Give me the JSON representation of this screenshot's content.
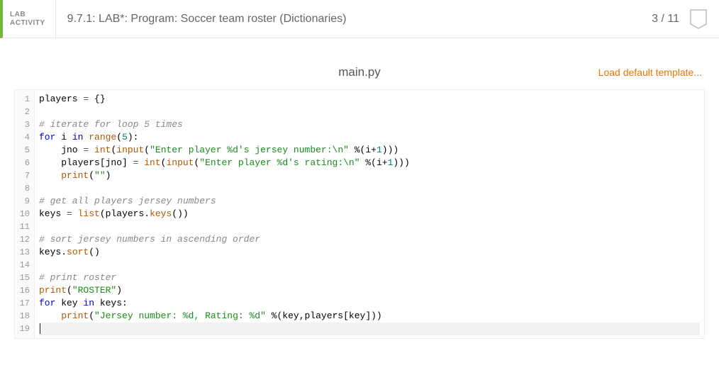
{
  "header": {
    "badge_line1": "LAB",
    "badge_line2": "ACTIVITY",
    "title": "9.7.1: LAB*: Program: Soccer team roster (Dictionaries)",
    "score": "3 / 11"
  },
  "file": {
    "name": "main.py",
    "load_template": "Load default template..."
  },
  "code_raw": "players = {}\n\n# iterate for loop 5 times\nfor i in range(5):\n    jno = int(input(\"Enter player %d's jersey number:\\n\" %(i+1)))\n    players[jno] = int(input(\"Enter player %d's rating:\\n\" %(i+1)))\n    print(\"\")\n\n# get all players jersey numbers\nkeys = list(players.keys())\n\n# sort jersey numbers in ascending order\nkeys.sort()\n\n# print roster\nprint(\"ROSTER\")\nfor key in keys:\n    print(\"Jersey number: %d, Rating: %d\" %(key,players[key]))\n",
  "code": [
    {
      "n": 1,
      "tokens": [
        {
          "t": "players ",
          "c": ""
        },
        {
          "t": "=",
          "c": "op"
        },
        {
          "t": " {}",
          "c": ""
        }
      ]
    },
    {
      "n": 2,
      "tokens": []
    },
    {
      "n": 3,
      "tokens": [
        {
          "t": "# iterate for loop 5 times",
          "c": "cmt"
        }
      ]
    },
    {
      "n": 4,
      "tokens": [
        {
          "t": "for",
          "c": "kw"
        },
        {
          "t": " i ",
          "c": ""
        },
        {
          "t": "in",
          "c": "kw"
        },
        {
          "t": " ",
          "c": ""
        },
        {
          "t": "range",
          "c": "fn"
        },
        {
          "t": "(",
          "c": ""
        },
        {
          "t": "5",
          "c": "num"
        },
        {
          "t": "):",
          "c": ""
        }
      ]
    },
    {
      "n": 5,
      "tokens": [
        {
          "t": "    jno ",
          "c": ""
        },
        {
          "t": "=",
          "c": "op"
        },
        {
          "t": " ",
          "c": ""
        },
        {
          "t": "int",
          "c": "fn"
        },
        {
          "t": "(",
          "c": ""
        },
        {
          "t": "input",
          "c": "fn"
        },
        {
          "t": "(",
          "c": ""
        },
        {
          "t": "\"Enter player %d's jersey number:\\n\"",
          "c": "str"
        },
        {
          "t": " %(i+",
          "c": ""
        },
        {
          "t": "1",
          "c": "num"
        },
        {
          "t": ")))",
          "c": ""
        }
      ]
    },
    {
      "n": 6,
      "tokens": [
        {
          "t": "    players[jno] ",
          "c": ""
        },
        {
          "t": "=",
          "c": "op"
        },
        {
          "t": " ",
          "c": ""
        },
        {
          "t": "int",
          "c": "fn"
        },
        {
          "t": "(",
          "c": ""
        },
        {
          "t": "input",
          "c": "fn"
        },
        {
          "t": "(",
          "c": ""
        },
        {
          "t": "\"Enter player %d's rating:\\n\"",
          "c": "str"
        },
        {
          "t": " %(i+",
          "c": ""
        },
        {
          "t": "1",
          "c": "num"
        },
        {
          "t": ")))",
          "c": ""
        }
      ]
    },
    {
      "n": 7,
      "tokens": [
        {
          "t": "    ",
          "c": ""
        },
        {
          "t": "print",
          "c": "fn"
        },
        {
          "t": "(",
          "c": ""
        },
        {
          "t": "\"\"",
          "c": "str"
        },
        {
          "t": ")",
          "c": ""
        }
      ]
    },
    {
      "n": 8,
      "tokens": []
    },
    {
      "n": 9,
      "tokens": [
        {
          "t": "# get all players jersey numbers",
          "c": "cmt"
        }
      ]
    },
    {
      "n": 10,
      "tokens": [
        {
          "t": "keys ",
          "c": ""
        },
        {
          "t": "=",
          "c": "op"
        },
        {
          "t": " ",
          "c": ""
        },
        {
          "t": "list",
          "c": "fn"
        },
        {
          "t": "(players.",
          "c": ""
        },
        {
          "t": "keys",
          "c": "fn"
        },
        {
          "t": "())",
          "c": ""
        }
      ]
    },
    {
      "n": 11,
      "tokens": []
    },
    {
      "n": 12,
      "tokens": [
        {
          "t": "# sort jersey numbers in ascending order",
          "c": "cmt"
        }
      ]
    },
    {
      "n": 13,
      "tokens": [
        {
          "t": "keys.",
          "c": ""
        },
        {
          "t": "sort",
          "c": "fn"
        },
        {
          "t": "()",
          "c": ""
        }
      ]
    },
    {
      "n": 14,
      "tokens": []
    },
    {
      "n": 15,
      "tokens": [
        {
          "t": "# print roster",
          "c": "cmt"
        }
      ]
    },
    {
      "n": 16,
      "tokens": [
        {
          "t": "print",
          "c": "fn"
        },
        {
          "t": "(",
          "c": ""
        },
        {
          "t": "\"ROSTER\"",
          "c": "str"
        },
        {
          "t": ")",
          "c": ""
        }
      ]
    },
    {
      "n": 17,
      "tokens": [
        {
          "t": "for",
          "c": "kw"
        },
        {
          "t": " key ",
          "c": ""
        },
        {
          "t": "in",
          "c": "kw"
        },
        {
          "t": " keys:",
          "c": ""
        }
      ]
    },
    {
      "n": 18,
      "tokens": [
        {
          "t": "    ",
          "c": ""
        },
        {
          "t": "print",
          "c": "fn"
        },
        {
          "t": "(",
          "c": ""
        },
        {
          "t": "\"Jersey number: %d, Rating: %d\"",
          "c": "str"
        },
        {
          "t": " %(key,players[key]))",
          "c": ""
        }
      ]
    },
    {
      "n": 19,
      "tokens": [],
      "active": true,
      "cursor": true
    }
  ]
}
